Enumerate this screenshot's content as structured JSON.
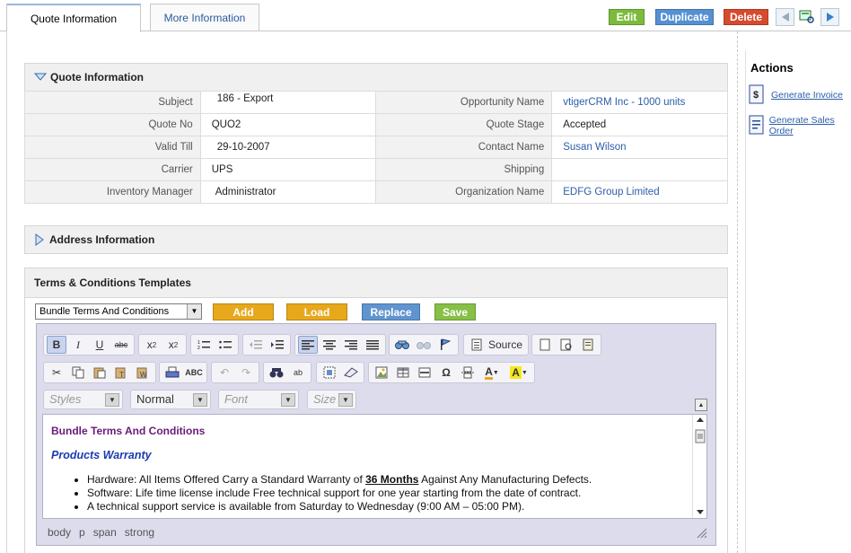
{
  "tabs": [
    {
      "label": "Quote Information"
    },
    {
      "label": "More Information"
    }
  ],
  "top_actions": {
    "edit": "Edit",
    "duplicate": "Duplicate",
    "delete": "Delete"
  },
  "colors": {
    "edit": "#7cbb3c",
    "duplicate": "#5590d2",
    "delete": "#d64a2e",
    "yellow_btn": "#e8a81c",
    "blue_btn": "#5f94d0",
    "green_btn": "#86c046"
  },
  "quote_section": {
    "title": "Quote Information",
    "rows": [
      {
        "l1": "Subject",
        "v1": "186 - Export",
        "l2": "Opportunity Name",
        "v2": "vtigerCRM Inc - 1000 units"
      },
      {
        "l1": "Quote No",
        "v1": "QUO2",
        "l2": "Quote Stage",
        "v2": "Accepted"
      },
      {
        "l1": "Valid Till",
        "v1": "29-10-2007",
        "l2": "Contact Name",
        "v2": "Susan Wilson"
      },
      {
        "l1": "Carrier",
        "v1": "UPS",
        "l2": "Shipping",
        "v2": ""
      },
      {
        "l1": "Inventory Manager",
        "v1": "Administrator",
        "l2": "Organization Name",
        "v2": "EDFG Group Limited"
      }
    ]
  },
  "address_section": {
    "title": "Address Information"
  },
  "terms": {
    "title": "Terms & Conditions Templates",
    "selected_template": "Bundle Terms And Conditions",
    "buttons": {
      "add": "Add",
      "load": "Load",
      "replace": "Replace",
      "save": "Save"
    }
  },
  "editor": {
    "source_label": "Source",
    "combos": {
      "styles": "Styles",
      "format": "Normal",
      "font": "Font",
      "size": "Size"
    },
    "content": {
      "heading": "Bundle Terms And Conditions",
      "subheading": "Products Warranty",
      "bullet1_pre": "Hardware: All Items Offered Carry a Standard Warranty of ",
      "bullet1_bold": "36 Months",
      "bullet1_post": " Against Any Manufacturing Defects.",
      "bullet2": "Software: Life time license include Free technical support for one year starting from the date of contract.",
      "bullet3": "A technical support service is available from Saturday to Wednesday (9:00 AM – 05:00 PM)."
    },
    "path": [
      "body",
      "p",
      "span",
      "strong"
    ]
  },
  "sidebar": {
    "title": "Actions",
    "items": [
      {
        "label": "Generate Invoice",
        "icon": "invoice-icon"
      },
      {
        "label": "Generate Sales Order",
        "icon": "sales-order-icon"
      }
    ]
  }
}
